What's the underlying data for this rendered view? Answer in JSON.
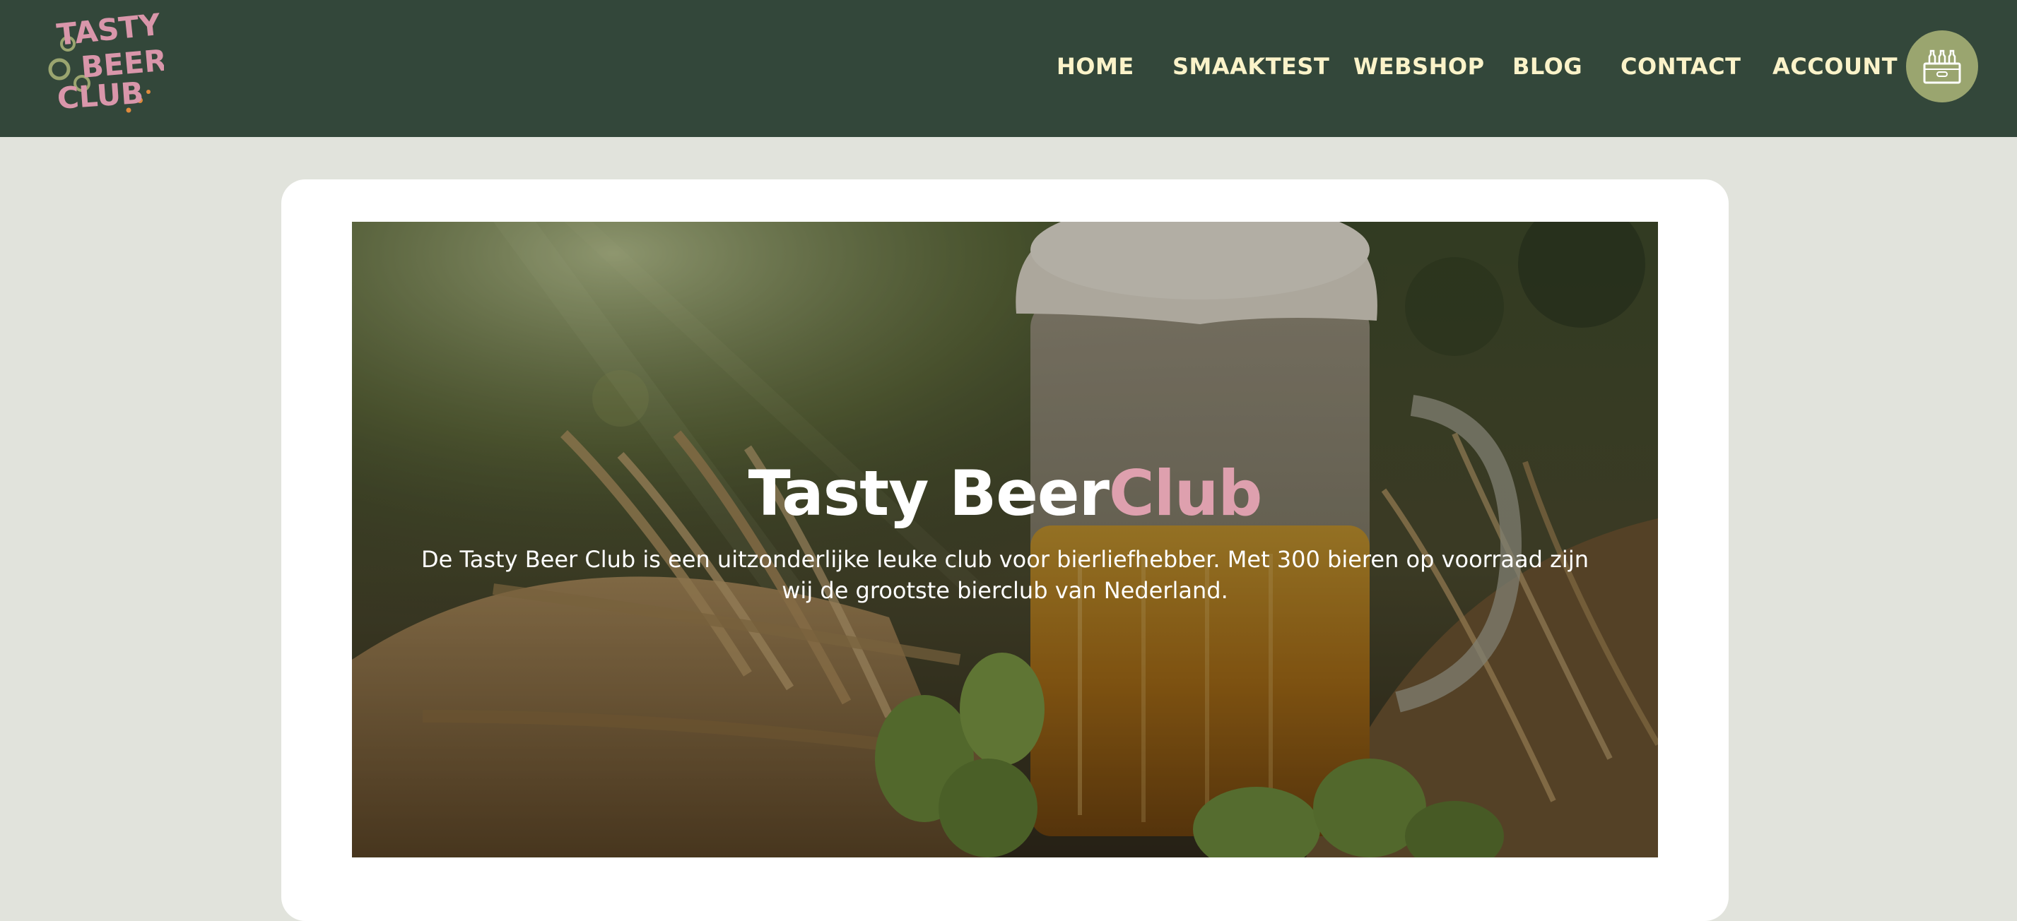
{
  "brand": {
    "logo_lines": [
      "TASTY",
      "BEER",
      "CLUB"
    ],
    "logo_colors": {
      "text": "#d996aa",
      "rings": "#9aa56f",
      "dots": "#e08a3c"
    }
  },
  "nav": {
    "items": [
      {
        "label": "HOME"
      },
      {
        "label": "SMAAKTEST"
      },
      {
        "label": "WEBSHOP"
      },
      {
        "label": "BLOG"
      },
      {
        "label": "CONTACT"
      },
      {
        "label": "ACCOUNT"
      }
    ],
    "cart_icon": "beer-crate-icon"
  },
  "hero": {
    "title_main": "Tasty Beer",
    "title_accent": "Club",
    "text": "De Tasty Beer Club is een uitzonderlijke leuke club voor bierliefhebber. Met 300 bieren op voorraad zijn wij de grootste bierclub van Nederland.",
    "image": "beer-mug-with-wheat-and-hops"
  },
  "colors": {
    "header_bg": "#33473a",
    "page_bg": "#e1e3dc",
    "nav_text": "#fbf3c9",
    "accent_pink": "#dea0ae",
    "cart_bg": "#9aa56f"
  }
}
